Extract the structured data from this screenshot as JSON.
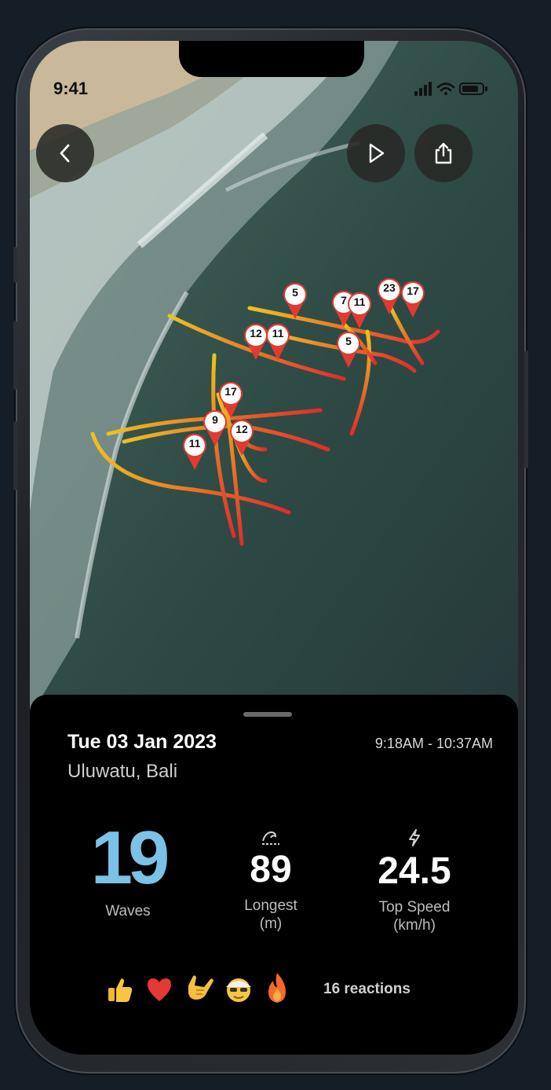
{
  "status_bar": {
    "time": "9:41"
  },
  "map": {
    "markers": [
      "5",
      "7",
      "11",
      "23",
      "17",
      "12",
      "11",
      "5",
      "17",
      "9",
      "12",
      "11"
    ]
  },
  "nav": {
    "back_icon": "chevron-left-icon",
    "play_icon": "play-icon",
    "share_icon": "share-icon"
  },
  "session": {
    "date": "Tue 03 Jan 2023",
    "time_range": "9:18AM - 10:37AM",
    "location": "Uluwatu, Bali"
  },
  "stats": {
    "waves": {
      "value": "19",
      "label": "Waves"
    },
    "longest": {
      "value": "89",
      "label": "Longest",
      "unit": "(m)",
      "icon": "wave-icon"
    },
    "top_speed": {
      "value": "24.5",
      "label": "Top Speed",
      "unit": "(km/h)",
      "icon": "lightning-icon"
    }
  },
  "reactions": {
    "emojis": [
      "thumbs-up",
      "heart",
      "shaka",
      "surfer-face",
      "fire"
    ],
    "count_text": "16 reactions"
  },
  "colors": {
    "accent": "#7cc1e6",
    "track_yellow": "#f0c020",
    "track_red": "#e03030"
  }
}
